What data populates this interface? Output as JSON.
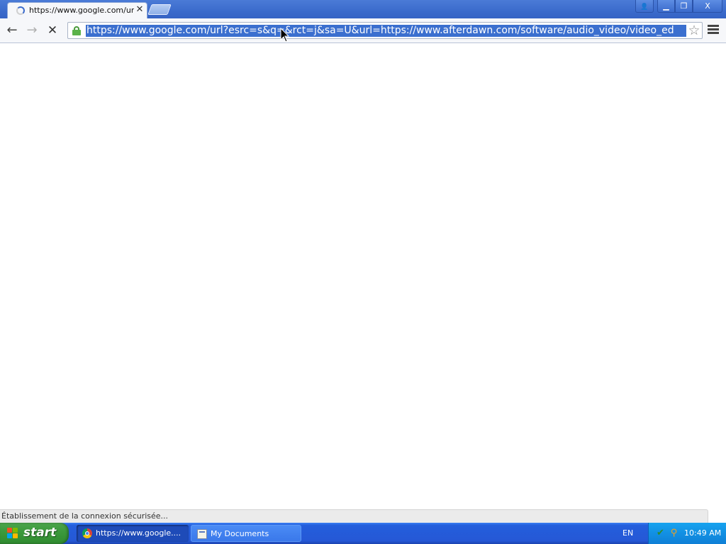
{
  "browser": {
    "tab": {
      "title": "https://www.google.com/url",
      "close_glyph": "✕"
    },
    "window_buttons": {
      "profile_glyph": "👤",
      "minimize_glyph": "▁",
      "maximize_glyph": "❐",
      "close_glyph": "X"
    },
    "toolbar": {
      "back_glyph": "←",
      "forward_glyph": "→",
      "stop_glyph": "✕",
      "url": "https://www.google.com/url?esrc=s&q=&rct=j&sa=U&url=https://www.afterdawn.com/software/audio_video/video_ed",
      "star_glyph": "☆"
    },
    "status": "Établissement de la connexion sécurisée..."
  },
  "taskbar": {
    "start_label": "start",
    "tasks": [
      {
        "label": "https://www.google....",
        "icon": "chrome-icon"
      },
      {
        "label": "My Documents",
        "icon": "folder-icon"
      }
    ],
    "language": "EN",
    "clock": "10:49 AM"
  },
  "colors": {
    "url_selection": "#3b6fcf",
    "xp_taskbar": "#245edc",
    "start_green": "#3c9a3c",
    "tray_blue": "#1290e3"
  }
}
